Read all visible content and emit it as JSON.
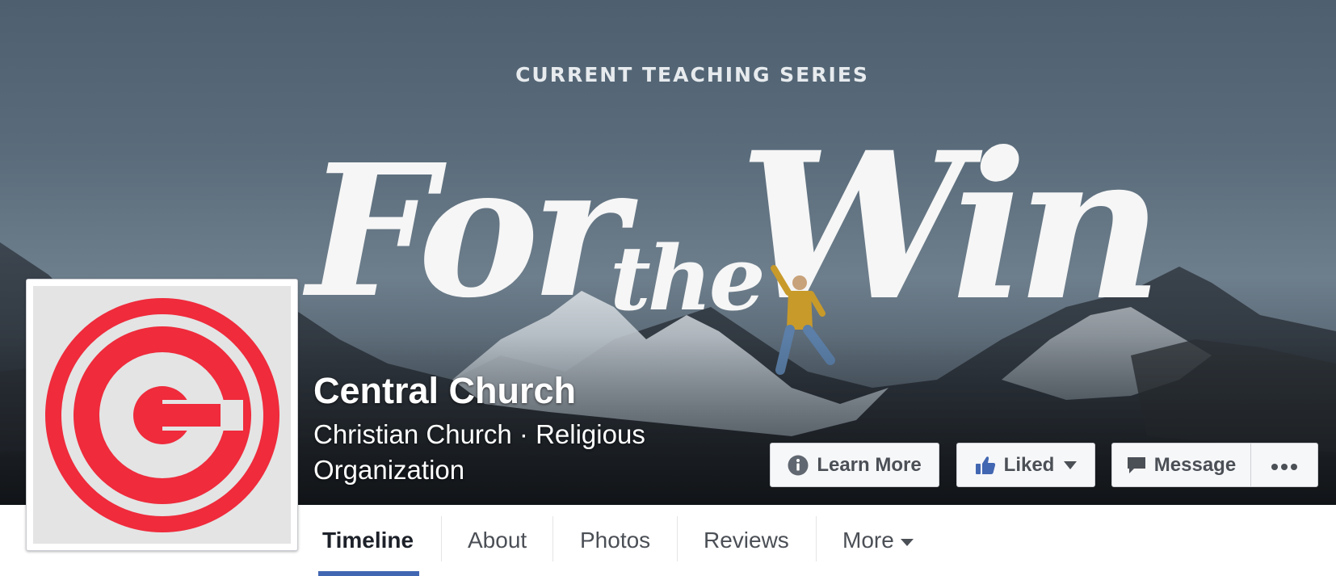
{
  "cover": {
    "kicker": "CURRENT TEACHING SERIES",
    "title_part1": "For",
    "title_part2": "the",
    "title_part3": "Win",
    "colors": {
      "sky": "#5a6c7b",
      "lettering": "#f6f6f6"
    }
  },
  "page": {
    "name": "Central Church",
    "category": "Christian Church · Religious Organization"
  },
  "actions": {
    "learn_more": "Learn More",
    "liked": "Liked",
    "message": "Message",
    "more_icon": "ellipsis-icon"
  },
  "tabs": {
    "items": [
      "Timeline",
      "About",
      "Photos",
      "Reviews",
      "More"
    ],
    "active": "Timeline"
  },
  "brand": {
    "logo_color": "#ef2b3c",
    "like_blue": "#4267b2"
  }
}
